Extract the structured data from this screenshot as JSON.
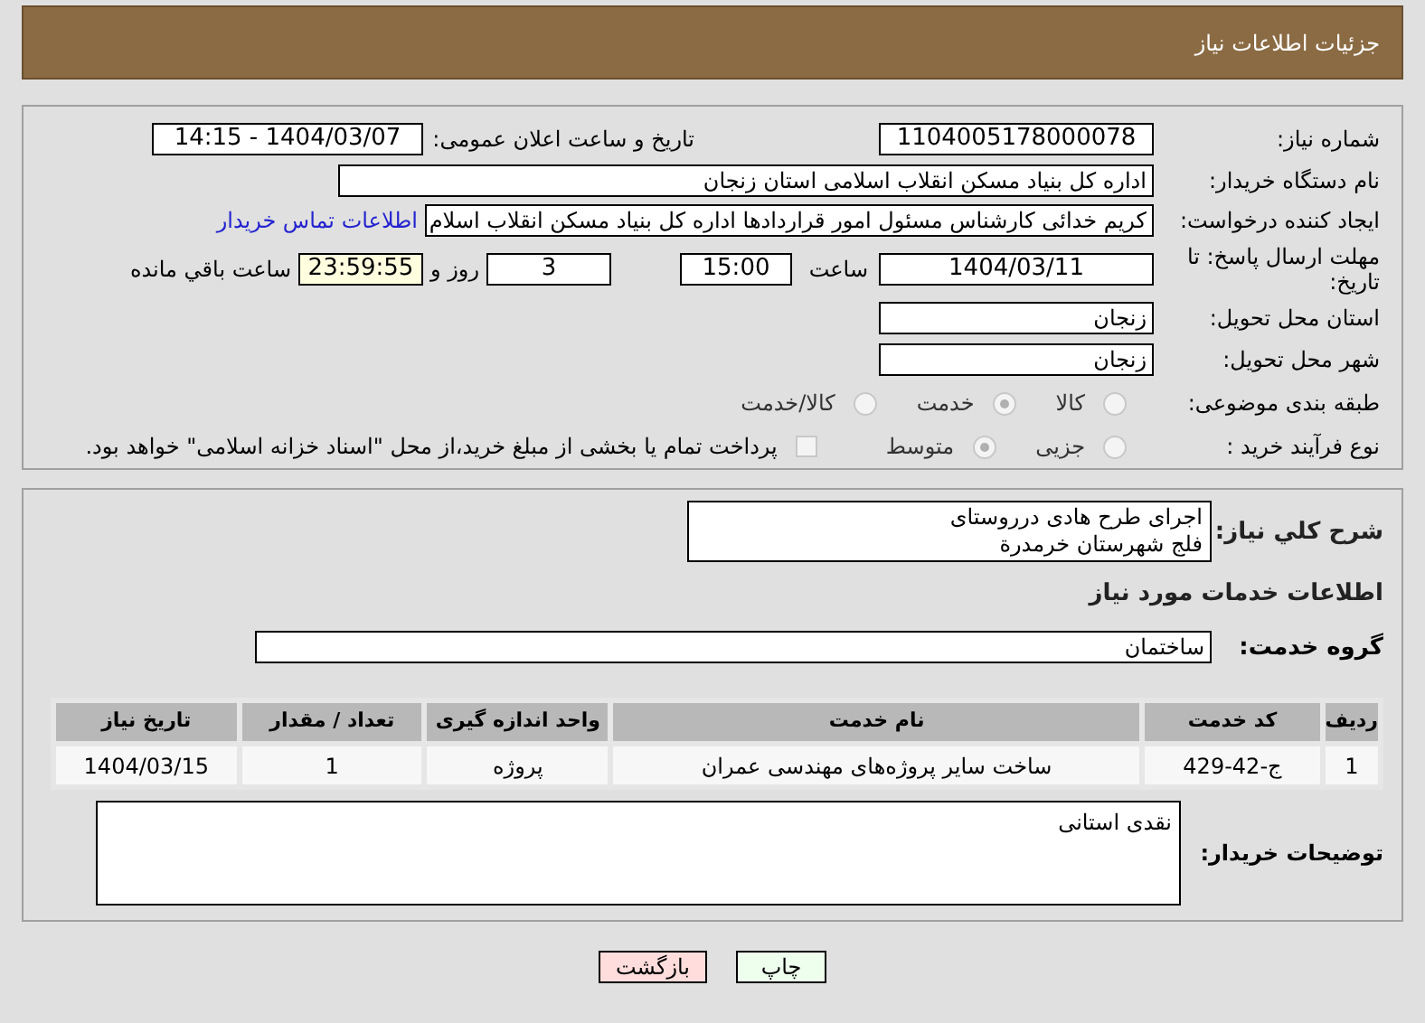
{
  "header": {
    "title": "جزئیات اطلاعات نیاز"
  },
  "fields": {
    "need_number": {
      "label": "شماره نیاز:",
      "value": "1104005178000078"
    },
    "announce": {
      "label": "تاریخ و ساعت اعلان عمومی:",
      "value": "1404/03/07 - 14:15"
    },
    "buyer": {
      "label": "نام دستگاه خریدار:",
      "value": "اداره کل بنیاد مسکن انقلاب اسلامی استان زنجان"
    },
    "requester": {
      "label": "ایجاد کننده درخواست:",
      "value": "کریم خدائی کارشناس مسئول امور قراردادها اداره کل بنیاد مسکن انقلاب اسلام",
      "link": "اطلاعات تماس خریدار"
    },
    "deadline": {
      "label": "مهلت ارسال پاسخ: تا تاریخ:",
      "date": "1404/03/11",
      "time_label": "ساعت",
      "time": "15:00",
      "days": "3",
      "days_label": "روز و",
      "remaining": "23:59:55",
      "remaining_label": "ساعت باقي مانده"
    },
    "province": {
      "label": "استان محل تحویل:",
      "value": "زنجان"
    },
    "city": {
      "label": "شهر محل تحویل:",
      "value": "زنجان"
    }
  },
  "category": {
    "label": "طبقه بندی موضوعی:",
    "options": [
      {
        "label": "کالا",
        "selected": false
      },
      {
        "label": "خدمت",
        "selected": true
      },
      {
        "label": "کالا/خدمت",
        "selected": false
      }
    ]
  },
  "process": {
    "label": "نوع فرآیند خرید :",
    "options": [
      {
        "label": "جزیی",
        "selected": false
      },
      {
        "label": "متوسط",
        "selected": true
      }
    ],
    "payment": {
      "checked": false,
      "text": "پرداخت تمام یا بخشی از مبلغ خرید،از محل \"اسناد خزانه اسلامی\" خواهد بود."
    }
  },
  "description": {
    "label": "شرح کلي نياز:",
    "lines": [
      "اجرای طرح هادی درروستای",
      "فلج شهرستان خرمدرة"
    ]
  },
  "services_title": "اطلاعات خدمات مورد نیاز",
  "service_group": {
    "label": "گروه خدمت:",
    "value": "ساختمان"
  },
  "table": {
    "columns": [
      "ردیف",
      "کد خدمت",
      "نام خدمت",
      "واحد اندازه گیری",
      "تعداد / مقدار",
      "تاریخ نیاز"
    ],
    "rows": [
      [
        "1",
        "ج-42-429",
        "ساخت سایر پروژه‌های مهندسی عمران",
        "پروژه",
        "1",
        "1404/03/15"
      ]
    ]
  },
  "buyer_notes": {
    "label": "توضیحات خریدار:",
    "value": "نقدی استانی"
  },
  "buttons": [
    {
      "label": "چاپ",
      "kind": "print"
    },
    {
      "label": "بازگشت",
      "kind": "back"
    }
  ]
}
